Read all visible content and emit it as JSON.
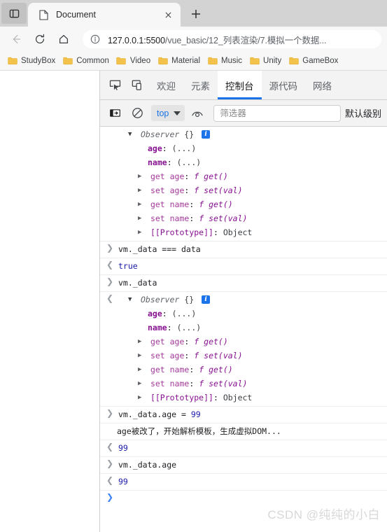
{
  "browser": {
    "tab": {
      "title": "Document",
      "favicon_icon": "page-icon",
      "close_icon": "close-icon"
    },
    "tab_search_icon": "tab-search-icon",
    "new_tab_label": "+",
    "nav": {
      "back_icon": "back-arrow-icon",
      "reload_icon": "reload-icon",
      "home_icon": "home-icon"
    },
    "omnibox": {
      "info_icon": "info-circle-icon",
      "host": "127.0.0.1:5500",
      "path": "/vue_basic/12_列表渲染/7.模拟一个数据...",
      "full_url": "127.0.0.1:5500/vue_basic/12_列表渲染/7.模拟一个数据..."
    },
    "bookmarks": [
      {
        "label": "StudyBox",
        "icon": "folder-icon"
      },
      {
        "label": "Common",
        "icon": "folder-icon"
      },
      {
        "label": "Video",
        "icon": "folder-icon"
      },
      {
        "label": "Material",
        "icon": "folder-icon"
      },
      {
        "label": "Music",
        "icon": "folder-icon"
      },
      {
        "label": "Unity",
        "icon": "folder-icon"
      },
      {
        "label": "GameBox",
        "icon": "folder-icon"
      }
    ]
  },
  "devtools": {
    "inspect_icon": "inspect-element-icon",
    "device_icon": "device-toolbar-icon",
    "tabs": [
      {
        "label": "欢迎",
        "active": false
      },
      {
        "label": "元素",
        "active": false
      },
      {
        "label": "控制台",
        "active": true
      },
      {
        "label": "源代码",
        "active": false
      },
      {
        "label": "网络",
        "active": false
      }
    ],
    "toolbar": {
      "sidebar_icon": "console-sidebar-icon",
      "clear_icon": "clear-console-icon",
      "context_value": "top",
      "context_caret_icon": "chevron-down-icon",
      "eye_icon": "live-expression-icon",
      "filter_placeholder": "筛选器",
      "filter_value": "",
      "level_label": "默认级别"
    },
    "accent_color": "#1a73e8"
  },
  "console": {
    "messages": [
      {
        "kind": "object-result",
        "gutter": "",
        "class_name": "Observer",
        "braces": "{}",
        "info_badge": "i",
        "props": [
          {
            "arrow": "",
            "name": "age",
            "sep": ":",
            "value": "(...)",
            "style": "dim"
          },
          {
            "arrow": "",
            "name": "name",
            "sep": ":",
            "value": "(...)",
            "style": "dim"
          },
          {
            "arrow": "right",
            "accessor": "get age",
            "sep": ":",
            "fn_kw": "f",
            "fn_sig": "get()"
          },
          {
            "arrow": "right",
            "accessor": "set age",
            "sep": ":",
            "fn_kw": "f",
            "fn_sig": "set(val)"
          },
          {
            "arrow": "right",
            "accessor": "get name",
            "sep": ":",
            "fn_kw": "f",
            "fn_sig": "get()"
          },
          {
            "arrow": "right",
            "accessor": "set name",
            "sep": ":",
            "fn_kw": "f",
            "fn_sig": "set(val)"
          },
          {
            "arrow": "right",
            "proto": "[[Prototype]]",
            "sep": ":",
            "proto_value": "Object"
          }
        ]
      },
      {
        "kind": "input",
        "gutter": ">",
        "text": "vm._data === data"
      },
      {
        "kind": "output-bool",
        "gutter": "<",
        "text": "true"
      },
      {
        "kind": "input",
        "gutter": ">",
        "text": "vm._data"
      },
      {
        "kind": "object-result",
        "gutter": "<",
        "class_name": "Observer",
        "braces": "{}",
        "info_badge": "i",
        "props": [
          {
            "arrow": "",
            "name": "age",
            "sep": ":",
            "value": "(...)",
            "style": "dim"
          },
          {
            "arrow": "",
            "name": "name",
            "sep": ":",
            "value": "(...)",
            "style": "dim"
          },
          {
            "arrow": "right",
            "accessor": "get age",
            "sep": ":",
            "fn_kw": "f",
            "fn_sig": "get()"
          },
          {
            "arrow": "right",
            "accessor": "set age",
            "sep": ":",
            "fn_kw": "f",
            "fn_sig": "set(val)"
          },
          {
            "arrow": "right",
            "accessor": "get name",
            "sep": ":",
            "fn_kw": "f",
            "fn_sig": "get()"
          },
          {
            "arrow": "right",
            "accessor": "set name",
            "sep": ":",
            "fn_kw": "f",
            "fn_sig": "set(val)"
          },
          {
            "arrow": "right",
            "proto": "[[Prototype]]",
            "sep": ":",
            "proto_value": "Object"
          }
        ]
      },
      {
        "kind": "input-assign",
        "gutter": ">",
        "prefix": "vm._data.age = ",
        "number": "99"
      },
      {
        "kind": "log",
        "gutter": "",
        "text": "age被改了，开始解析模板，生成虚拟DOM..."
      },
      {
        "kind": "output-num",
        "gutter": "<",
        "text": "99"
      },
      {
        "kind": "input",
        "gutter": ">",
        "text": "vm._data.age"
      },
      {
        "kind": "output-num",
        "gutter": "<",
        "text": "99"
      },
      {
        "kind": "prompt",
        "gutter": ">",
        "text": ""
      }
    ]
  },
  "watermark": "CSDN @纯纯的小白"
}
